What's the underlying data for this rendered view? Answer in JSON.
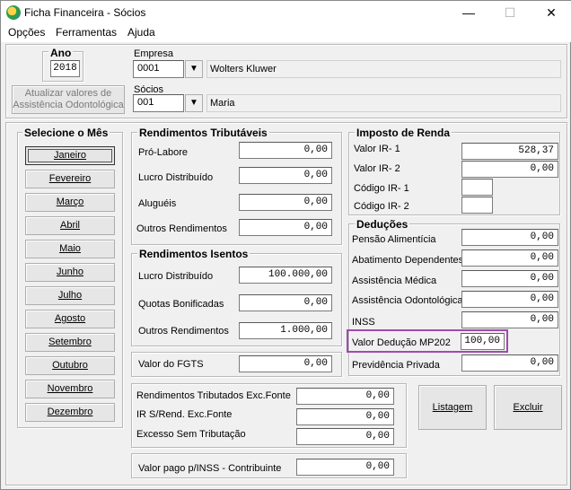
{
  "window": {
    "title": "Ficha Financeira - Sócios",
    "minimize": "—",
    "maximize": "☐",
    "close": "✕"
  },
  "menu": {
    "opcoes": "Opções",
    "ferramentas": "Ferramentas",
    "ajuda": "Ajuda"
  },
  "header": {
    "ano_label": "Ano",
    "ano_value": "2018",
    "empresa_label": "Empresa",
    "empresa_code": "0001",
    "empresa_name": "Wolters Kluwer",
    "socios_label": "Sócios",
    "socio_code": "001",
    "socio_name": "Maria",
    "update_btn_line1": "Atualizar valores de",
    "update_btn_line2": "Assistência Odontológica"
  },
  "months": {
    "title": "Selecione o Mês",
    "items": [
      "Janeiro",
      "Fevereiro",
      "Março",
      "Abril",
      "Maio",
      "Junho",
      "Julho",
      "Agosto",
      "Setembro",
      "Outubro",
      "Novembro",
      "Dezembro"
    ]
  },
  "tributaveis": {
    "title": "Rendimentos Tributáveis",
    "pro_labore_label": "Pró-Labore",
    "pro_labore": "0,00",
    "lucro_label": "Lucro Distribuído",
    "lucro": "0,00",
    "alugueis_label": "Aluguéis",
    "alugueis": "0,00",
    "outros_label": "Outros Rendimentos",
    "outros": "0,00"
  },
  "isentos": {
    "title": "Rendimentos Isentos",
    "lucro_label": "Lucro Distribuído",
    "lucro": "100.000,00",
    "quotas_label": "Quotas Bonificadas",
    "quotas": "0,00",
    "outros_label": "Outros Rendimentos",
    "outros": "1.000,00"
  },
  "fgts": {
    "label": "Valor do FGTS",
    "value": "0,00"
  },
  "fonte": {
    "trib_label": "Rendimentos Tributados Exc.Fonte",
    "trib": "0,00",
    "ir_label": "IR S/Rend. Exc.Fonte",
    "ir": "0,00",
    "excesso_label": "Excesso Sem Tributação",
    "excesso": "0,00"
  },
  "inss_contrib": {
    "label": "Valor pago p/INSS - Contribuinte",
    "value": "0,00"
  },
  "imposto": {
    "title": "Imposto de Renda",
    "ir1_label": "Valor IR- 1",
    "ir1": "528,37",
    "ir2_label": "Valor IR- 2",
    "ir2": "0,00",
    "cod1_label": "Código IR- 1",
    "cod1": "",
    "cod2_label": "Código IR- 2",
    "cod2": ""
  },
  "deducoes": {
    "title": "Deduções",
    "pensao_label": "Pensão Alimentícia",
    "pensao": "0,00",
    "abatimento_label": "Abatimento Dependentes",
    "abatimento": "0,00",
    "medica_label": "Assistência Médica",
    "medica": "0,00",
    "odonto_label": "Assistência Odontológica",
    "odonto": "0,00",
    "inss_label": "INSS",
    "inss": "0,00",
    "mp202_label": "Valor Dedução MP202",
    "mp202": "100,00",
    "previdencia_label": "Previdência Privada",
    "previdencia": "0,00"
  },
  "actions": {
    "listagem": "Listagem",
    "excluir": "Excluir"
  }
}
